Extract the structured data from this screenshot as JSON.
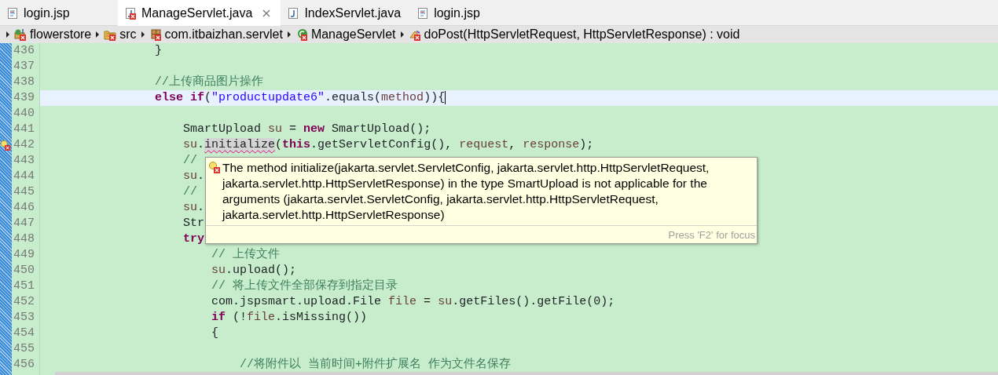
{
  "tabs": [
    {
      "label": "login.jsp",
      "kind": "jsp",
      "selected": false,
      "error": false,
      "closable": false
    },
    {
      "label": "ManageServlet.java",
      "kind": "java",
      "selected": true,
      "error": true,
      "closable": true
    },
    {
      "label": "IndexServlet.java",
      "kind": "java",
      "selected": false,
      "error": false,
      "closable": false
    },
    {
      "label": "login.jsp",
      "kind": "jsp",
      "selected": false,
      "error": false,
      "closable": false
    }
  ],
  "breadcrumb": [
    {
      "label": "flowerstore",
      "kind": "project"
    },
    {
      "label": "src",
      "kind": "folder"
    },
    {
      "label": "com.itbaizhan.servlet",
      "kind": "package"
    },
    {
      "label": "ManageServlet",
      "kind": "class"
    },
    {
      "label": "doPost(HttpServletRequest, HttpServletResponse) : void",
      "kind": "method"
    }
  ],
  "editor": {
    "lines": [
      {
        "number": "436",
        "current": false,
        "error": false,
        "tokens": [
          {
            "kind": "plain",
            "text": "                }"
          }
        ]
      },
      {
        "number": "437",
        "current": false,
        "error": false
      },
      {
        "number": "438",
        "current": false,
        "error": false,
        "tokens": [
          {
            "kind": "comment",
            "text": "                //上传商品图片操作"
          }
        ]
      },
      {
        "number": "439",
        "current": true,
        "error": false,
        "tokens": [
          {
            "kind": "keyword",
            "text": "                else if"
          },
          {
            "kind": "plain",
            "text": "("
          },
          {
            "kind": "string",
            "text": "\"productupdate6\""
          },
          {
            "kind": "plain",
            "text": ".equals("
          },
          {
            "kind": "variable",
            "text": "method"
          },
          {
            "kind": "plain",
            "text": ")){"
          }
        ]
      },
      {
        "number": "440",
        "current": false,
        "error": false
      },
      {
        "number": "441",
        "current": false,
        "error": false,
        "tokens": [
          {
            "kind": "plain",
            "text": "                    SmartUpload "
          },
          {
            "kind": "variable",
            "text": "su"
          },
          {
            "kind": "plain",
            "text": " = "
          },
          {
            "kind": "keyword",
            "text": "new"
          },
          {
            "kind": "plain",
            "text": " SmartUpload();"
          }
        ]
      },
      {
        "number": "442",
        "current": false,
        "error": true,
        "tokens": [
          {
            "kind": "variable",
            "text": "                    su"
          },
          {
            "kind": "plain",
            "text": "."
          },
          {
            "kind": "error",
            "text": "initialize"
          },
          {
            "kind": "plain",
            "text": "("
          },
          {
            "kind": "keyword",
            "text": "this"
          },
          {
            "kind": "plain",
            "text": ".getServletConfig(), "
          },
          {
            "kind": "variable",
            "text": "request"
          },
          {
            "kind": "plain",
            "text": ", "
          },
          {
            "kind": "variable",
            "text": "response"
          },
          {
            "kind": "plain",
            "text": ");"
          }
        ]
      },
      {
        "number": "443",
        "current": false,
        "error": false,
        "tokens": [
          {
            "kind": "comment",
            "text": "                    //"
          }
        ]
      },
      {
        "number": "444",
        "current": false,
        "error": false,
        "tokens": [
          {
            "kind": "variable",
            "text": "                    su"
          },
          {
            "kind": "plain",
            "text": "."
          }
        ]
      },
      {
        "number": "445",
        "current": false,
        "error": false,
        "tokens": [
          {
            "kind": "comment",
            "text": "                    //"
          }
        ]
      },
      {
        "number": "446",
        "current": false,
        "error": false,
        "tokens": [
          {
            "kind": "variable",
            "text": "                    su"
          },
          {
            "kind": "plain",
            "text": "."
          }
        ]
      },
      {
        "number": "447",
        "current": false,
        "error": false,
        "tokens": [
          {
            "kind": "plain",
            "text": "                    Str"
          }
        ]
      },
      {
        "number": "448",
        "current": false,
        "error": false,
        "tokens": [
          {
            "kind": "keyword",
            "text": "                    try"
          }
        ]
      },
      {
        "number": "449",
        "current": false,
        "error": false,
        "tokens": [
          {
            "kind": "comment",
            "text": "                        // 上传文件"
          }
        ]
      },
      {
        "number": "450",
        "current": false,
        "error": false,
        "tokens": [
          {
            "kind": "variable",
            "text": "                        su"
          },
          {
            "kind": "plain",
            "text": ".upload();"
          }
        ]
      },
      {
        "number": "451",
        "current": false,
        "error": false,
        "tokens": [
          {
            "kind": "comment",
            "text": "                        // 将上传文件全部保存到指定目录"
          }
        ]
      },
      {
        "number": "452",
        "current": false,
        "error": false,
        "tokens": [
          {
            "kind": "plain",
            "text": "                        com.jspsmart.upload.File "
          },
          {
            "kind": "variable",
            "text": "file"
          },
          {
            "kind": "plain",
            "text": " = "
          },
          {
            "kind": "variable",
            "text": "su"
          },
          {
            "kind": "plain",
            "text": ".getFiles().getFile(0);"
          }
        ]
      },
      {
        "number": "453",
        "current": false,
        "error": false,
        "tokens": [
          {
            "kind": "keyword",
            "text": "                        if"
          },
          {
            "kind": "plain",
            "text": " (!"
          },
          {
            "kind": "variable",
            "text": "file"
          },
          {
            "kind": "plain",
            "text": ".isMissing())"
          }
        ]
      },
      {
        "number": "454",
        "current": false,
        "error": false,
        "tokens": [
          {
            "kind": "plain",
            "text": "                        {"
          }
        ]
      },
      {
        "number": "455",
        "current": false,
        "error": false
      },
      {
        "number": "456",
        "current": false,
        "error": false,
        "tokens": [
          {
            "kind": "comment",
            "text": "                            //将附件以 当前时间+附件扩展名 作为文件名保存"
          }
        ]
      }
    ]
  },
  "tooltip": {
    "message": "The method initialize(jakarta.servlet.ServletConfig, jakarta.servlet.http.HttpServletRequest, jakarta.servlet.http.HttpServletResponse) in the type SmartUpload is not applicable for the arguments (jakarta.servlet.ServletConfig, jakarta.servlet.http.HttpServletRequest, jakarta.servlet.http.HttpServletResponse)",
    "hint": "Press 'F2' for focus"
  }
}
